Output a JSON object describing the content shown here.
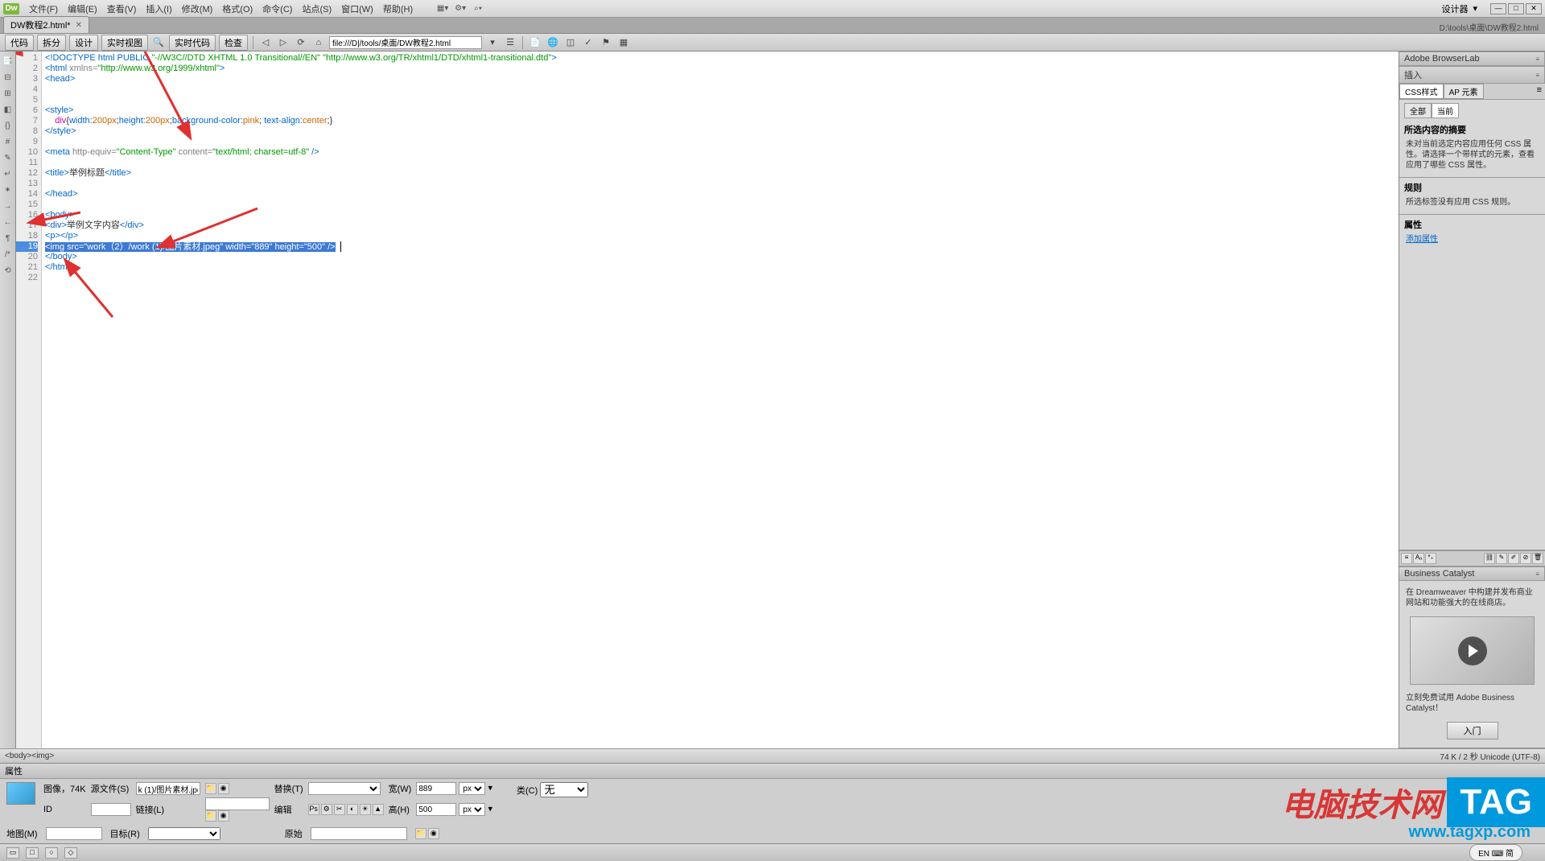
{
  "menubar": {
    "items": [
      "文件(F)",
      "编辑(E)",
      "查看(V)",
      "插入(I)",
      "修改(M)",
      "格式(O)",
      "命令(C)",
      "站点(S)",
      "窗口(W)",
      "帮助(H)"
    ],
    "logo": "Dw",
    "right_label": "设计器",
    "layout_icon": "▦▾",
    "find_icon": "⌕▾",
    "gear_icon": "⚙▾"
  },
  "tabs": {
    "file": "DW教程2.html*",
    "path": "D:\\tools\\桌面\\DW教程2.html"
  },
  "toolbar": {
    "buttons": [
      "代码",
      "拆分",
      "设计",
      "实时视图"
    ],
    "live_code": "实时代码",
    "inspect": "检查",
    "address": "file:///D|/tools/桌面/DW教程2.html"
  },
  "code": {
    "lines": [
      {
        "n": 1,
        "html": "<span class='c-blue'>&lt;!DOCTYPE html PUBLIC <span class='c-green'>\"-//W3C//DTD XHTML 1.0 Transitional//EN\" \"http://www.w3.org/TR/xhtml1/DTD/xhtml1-transitional.dtd\"</span>&gt;</span>"
      },
      {
        "n": 2,
        "html": "<span class='c-blue'>&lt;html <span class='c-gray'>xmlns=</span><span class='c-green'>\"http://www.w3.org/1999/xhtml\"</span>&gt;</span>"
      },
      {
        "n": 3,
        "html": "<span class='c-blue'>&lt;head&gt;</span>"
      },
      {
        "n": 4,
        "html": ""
      },
      {
        "n": 5,
        "html": ""
      },
      {
        "n": 6,
        "html": "<span class='c-blue'>&lt;style&gt;</span>"
      },
      {
        "n": 7,
        "html": "    <span class='c-pink'>div</span>{<span class='c-blue'>width:</span><span class='c-orange'>200px</span>;<span class='c-blue'>height:</span><span class='c-orange'>200px</span>;<span class='c-blue'>background-color:</span><span class='c-orange'>pink</span>; <span class='c-blue'>text-align:</span><span class='c-orange'>center</span>;}"
      },
      {
        "n": 8,
        "html": "<span class='c-blue'>&lt;/style&gt;</span>"
      },
      {
        "n": 9,
        "html": ""
      },
      {
        "n": 10,
        "html": "<span class='c-blue'>&lt;meta <span class='c-gray'>http-equiv=</span><span class='c-green'>\"Content-Type\"</span> <span class='c-gray'>content=</span><span class='c-green'>\"text/html; charset=utf-8\"</span> /&gt;</span>"
      },
      {
        "n": 11,
        "html": ""
      },
      {
        "n": 12,
        "html": "<span class='c-blue'>&lt;title&gt;</span>举例标题<span class='c-blue'>&lt;/title&gt;</span>"
      },
      {
        "n": 13,
        "html": ""
      },
      {
        "n": 14,
        "html": "<span class='c-blue'>&lt;/head&gt;</span>"
      },
      {
        "n": 15,
        "html": ""
      },
      {
        "n": 16,
        "html": "<span class='c-blue'>&lt;body&gt;</span>"
      },
      {
        "n": 17,
        "html": "<span class='c-blue'>&lt;div&gt;</span>举例文字内容<span class='c-blue'>&lt;/div&gt;</span>"
      },
      {
        "n": 18,
        "html": "<span class='c-blue'>&lt;p&gt;&lt;/p&gt;</span>"
      },
      {
        "n": 19,
        "html": "<span class='hl'>&lt;img src=\"work（2）/work (1)/图片素材.jpeg\" width=\"889\" height=\"500\" /&gt;</span>",
        "sel": true
      },
      {
        "n": 20,
        "html": "<span class='c-blue'>&lt;/body&gt;</span>"
      },
      {
        "n": 21,
        "html": "<span class='c-blue'>&lt;/html&gt;</span>"
      },
      {
        "n": 22,
        "html": ""
      }
    ]
  },
  "tagselector": {
    "path": "<body><img>",
    "status": "74 K / 2 秒 Unicode (UTF-8)"
  },
  "rightPanels": {
    "browserlab": "Adobe BrowserLab",
    "insert": "插入",
    "css_tabs": [
      "CSS样式",
      "AP 元素"
    ],
    "css_scope": [
      "全部",
      "当前"
    ],
    "css_heading": "所选内容的摘要",
    "css_text": "未对当前选定内容应用任何 CSS 属性。请选择一个带样式的元素，查看应用了哪些 CSS 属性。",
    "rules_heading": "规则",
    "rules_text": "所选标签没有应用 CSS 规则。",
    "attrs_heading": "属性",
    "add_attr": "添加属性",
    "bc_heading": "Business Catalyst",
    "bc_text": "在 Dreamweaver 中构建并发布商业网站和功能强大的在线商店。",
    "bc_cta": "立刻免费试用 Adobe Business Catalyst！",
    "bc_btn": "入门"
  },
  "props": {
    "header": "属性",
    "image_label": "图像，74K",
    "src_label": "源文件(S)",
    "src_value": "k (1)/图片素材.jpeg",
    "alt_label": "替换(T)",
    "id_label": "ID",
    "link_label": "链接(L)",
    "edit_label": "编辑",
    "w_label": "宽(W)",
    "w_value": "889",
    "h_label": "高(H)",
    "h_value": "500",
    "px": "px",
    "class_label": "类(C)",
    "class_value": "无",
    "map_label": "地图(M)",
    "target_label": "目标(R)",
    "orig_label": "原始"
  },
  "statusbar": {
    "lang": "EN ⌨ 简"
  },
  "watermark": {
    "text": "电脑技术网",
    "tag": "TAG",
    "url": "www.tagxp.com"
  }
}
